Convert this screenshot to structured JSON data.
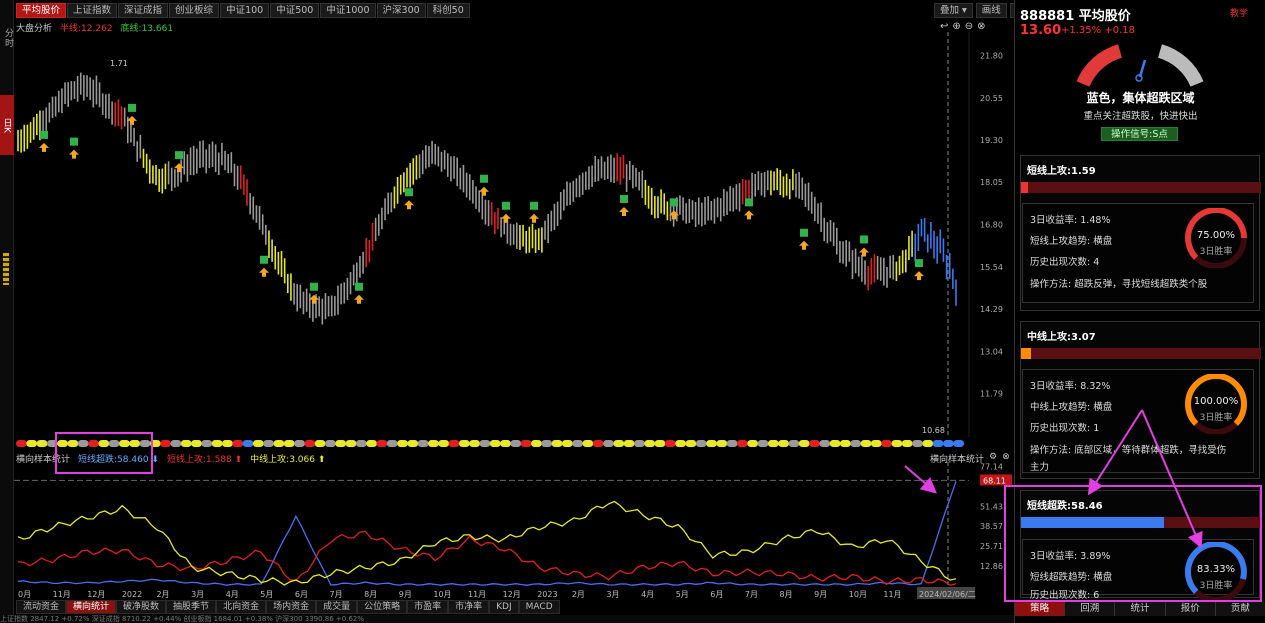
{
  "top_tabs": [
    "平均股价",
    "上证指数",
    "深证成指",
    "创业板综",
    "中证100",
    "中证500",
    "中证1000",
    "沪深300",
    "科创50"
  ],
  "top_right": {
    "overlay": "叠加 ▾",
    "draw": "画线",
    "grid": "▦"
  },
  "left_rail": {
    "fen": "分时",
    "rik": "日K"
  },
  "main_header": {
    "name": "大盘分析",
    "resist": "半线:12.262",
    "support": "底线:13.661"
  },
  "main_ticks": [
    "21.80",
    "20.55",
    "19.30",
    "18.05",
    "16.80",
    "15.54",
    "14.29",
    "13.04",
    "11.79"
  ],
  "main_low_label": "10.68",
  "peak_label": "1.71",
  "x_ticks": [
    "0月",
    "11月",
    "12月",
    "2022",
    "2月",
    "3月",
    "4月",
    "5月",
    "6月",
    "7月",
    "8月",
    "9月",
    "10月",
    "11月",
    "12月",
    "2023",
    "2月",
    "3月",
    "4月",
    "5月",
    "6月",
    "7月",
    "8月",
    "9月",
    "10月",
    "11月",
    "12月",
    "2024/02/06/二"
  ],
  "lower_header": {
    "name": "横向样本统计",
    "short_drop": "短线超跌:58.460 ⬇",
    "short_up": "短线上攻:1.588 ⬆",
    "mid_up": "中线上攻:3.066 ⬆"
  },
  "lower_right": {
    "name": "横向样本统计"
  },
  "lower_ticks": [
    "77.14",
    "68.11",
    "51.43",
    "38.57",
    "25.71",
    "12.86"
  ],
  "bottom_tabs": [
    "流动资金",
    "横向统计",
    "破净股数",
    "抽股季节",
    "北向资金",
    "场内资金",
    "成交量",
    "公位策略",
    "市盈率",
    "市净率",
    "KDJ",
    "MACD"
  ],
  "status_text": "上证指数 2847.12 +0.72%   深证成指 8710.22 +0.44%   创业板指 1684.01 +0.38%   沪深300 3390.86 +0.62%",
  "right": {
    "code_name": "888881 平均股价",
    "teach": "教学",
    "price": "13.60",
    "change": "+1.35% +0.18",
    "state": "蓝色，集体超跌区域",
    "focus": "重点关注超跌股，快进快出",
    "signal": "操作信号:S点",
    "sections": [
      {
        "title": "短线上攻:1.59",
        "l1": "3日收益率:  1.48%",
        "l2": "短线上攻趋势:  横盘",
        "l3": "历史出现次数:  4",
        "l4": "操作方法:  超跌反弹，寻找短线超跌类个股",
        "l5": "",
        "pct": "75.00%",
        "lab": "3日胜率"
      },
      {
        "title": "中线上攻:3.07",
        "l1": "3日收益率:  8.32%",
        "l2": "中线上攻趋势:  横盘",
        "l3": "历史出现次数:  1",
        "l4": "操作方法:  底部区域，等待群体超跌，寻找受伤",
        "l5": "主力",
        "pct": "100.00%",
        "lab": "3日胜率"
      },
      {
        "title": "短线超跌:58.46",
        "l1": "3日收益率:  3.89%",
        "l2": "短线超跌趋势:  横盘",
        "l3": "历史出现次数:  6",
        "l4": "",
        "l5": "",
        "pct": "83.33%",
        "lab": "3日胜率"
      }
    ],
    "bottom_tabs": [
      "策略",
      "回溯",
      "统计",
      "报价",
      "贡献"
    ]
  },
  "chart_data": [
    {
      "type": "line",
      "title": "",
      "series": [
        {
          "name": "半线",
          "values": [
            19.9,
            20.6,
            21.8,
            21.8,
            21.2,
            20.7,
            19.3,
            17.6,
            15.9,
            15.3,
            17.0,
            18.3,
            19.3,
            19.0,
            17.8,
            17.6,
            18.4,
            18.9,
            19.9,
            19.6,
            18.8,
            18.5,
            18.6,
            19.5,
            19.3,
            17.5,
            18.2,
            16.1
          ]
        },
        {
          "name": "底线",
          "values": [
            18.8,
            18.6,
            19.2,
            19.6,
            18.2,
            17.6,
            16.5,
            15.1,
            14.3,
            14.3,
            15.4,
            17.1,
            17.8,
            17.5,
            16.7,
            15.9,
            16.6,
            16.9,
            16.8,
            17.3,
            16.8,
            16.5,
            15.9,
            15.8,
            15.7,
            15.0,
            13.9,
            11.1
          ]
        }
      ],
      "ylim": [
        10.5,
        22.5
      ]
    },
    {
      "type": "line",
      "title": "",
      "series": [
        {
          "name": "短线超跌",
          "values": [
            3,
            2,
            2,
            3,
            4,
            2,
            1,
            1,
            45,
            1,
            2,
            1,
            1,
            1,
            1,
            1,
            2,
            1,
            1,
            1,
            2,
            1,
            1,
            1,
            1,
            2,
            1,
            68
          ]
        },
        {
          "name": "短线上攻",
          "values": [
            14,
            17,
            22,
            23,
            14,
            11,
            16,
            22,
            2,
            30,
            34,
            24,
            18,
            30,
            24,
            12,
            8,
            6,
            12,
            15,
            8,
            9,
            8,
            5,
            6,
            3,
            4,
            1.6
          ]
        },
        {
          "name": "中线上攻",
          "values": [
            30,
            38,
            44,
            50,
            38,
            12,
            8,
            4,
            2,
            8,
            12,
            16,
            28,
            32,
            30,
            38,
            42,
            54,
            46,
            38,
            20,
            22,
            30,
            36,
            25,
            30,
            16,
            3
          ]
        }
      ],
      "ylim": [
        0,
        80
      ]
    }
  ]
}
